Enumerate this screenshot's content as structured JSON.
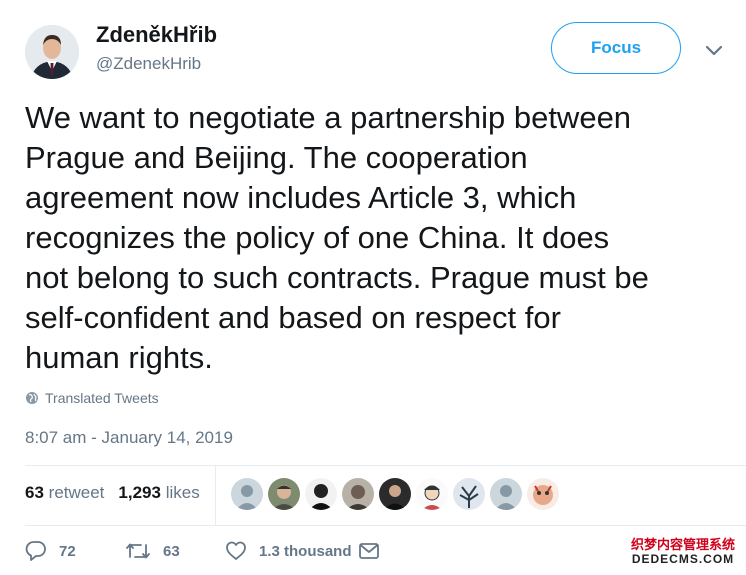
{
  "author": {
    "display_name": "ZdeněkHřib",
    "handle": "@ZdenekHrib"
  },
  "focus_label": "Focus",
  "tweet_text": "We want to negotiate a partnership between\nPrague and Beijing. The cooperation\nagreement now includes Article 3, which\nrecognizes the policy of one China. It does\nnot belong to such contracts. Prague must be\nself-confident and based on respect for\nhuman rights.",
  "translated_label": "Translated Tweets",
  "timestamp": "8:07 am - January 14, 2019",
  "stats": {
    "retweet_count": "63",
    "retweet_label": "retweet",
    "like_count": "1,293",
    "like_label": "likes"
  },
  "likers_count": 9,
  "actions": {
    "reply_count": "72",
    "retweet_count": "63",
    "like_count": "1.3 thousand"
  },
  "watermark": {
    "line1": "织梦内容管理系统",
    "line2": "DEDECMS.COM"
  },
  "colors": {
    "accent": "#1da1f2",
    "secondary_text": "#657786",
    "primary_text": "#14171a"
  }
}
